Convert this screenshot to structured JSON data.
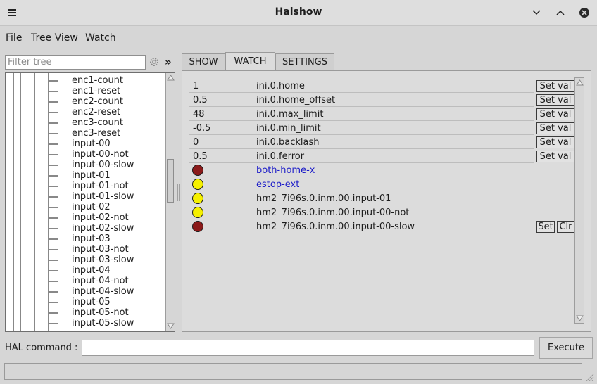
{
  "window": {
    "title": "Halshow"
  },
  "menu": [
    "File",
    "Tree View",
    "Watch"
  ],
  "filter": {
    "placeholder": "Filter tree",
    "more": "»"
  },
  "tree": {
    "items": [
      "enc1-count",
      "enc1-reset",
      "enc2-count",
      "enc2-reset",
      "enc3-count",
      "enc3-reset",
      "input-00",
      "input-00-not",
      "input-00-slow",
      "input-01",
      "input-01-not",
      "input-01-slow",
      "input-02",
      "input-02-not",
      "input-02-slow",
      "input-03",
      "input-03-not",
      "input-03-slow",
      "input-04",
      "input-04-not",
      "input-04-slow",
      "input-05",
      "input-05-not",
      "input-05-slow"
    ]
  },
  "tabs": [
    "SHOW",
    "WATCH",
    "SETTINGS"
  ],
  "active_tab": "WATCH",
  "watch": {
    "params": [
      {
        "value": "1",
        "name": "ini.0.home",
        "button": "Set val"
      },
      {
        "value": "0.5",
        "name": "ini.0.home_offset",
        "button": "Set val"
      },
      {
        "value": "48",
        "name": "ini.0.max_limit",
        "button": "Set val"
      },
      {
        "value": "-0.5",
        "name": "ini.0.min_limit",
        "button": "Set val"
      },
      {
        "value": "0",
        "name": "ini.0.backlash",
        "button": "Set val"
      },
      {
        "value": "0.5",
        "name": "ini.0.ferror",
        "button": "Set val"
      }
    ],
    "pins": [
      {
        "state": "off",
        "color": "#8b1a1a",
        "name": "both-home-x",
        "pin": true
      },
      {
        "state": "on",
        "color": "#f5f000",
        "name": "estop-ext",
        "pin": true
      },
      {
        "state": "on",
        "color": "#f5f000",
        "name": "hm2_7i96s.0.inm.00.input-01",
        "pin": false
      },
      {
        "state": "on",
        "color": "#f5f000",
        "name": "hm2_7i96s.0.inm.00.input-00-not",
        "pin": false
      },
      {
        "state": "off",
        "color": "#8b1a1a",
        "name": "hm2_7i96s.0.inm.00.input-00-slow",
        "pin": false,
        "set": "Set",
        "clr": "Clr"
      }
    ]
  },
  "command": {
    "label": "HAL command :",
    "value": "",
    "execute": "Execute"
  }
}
